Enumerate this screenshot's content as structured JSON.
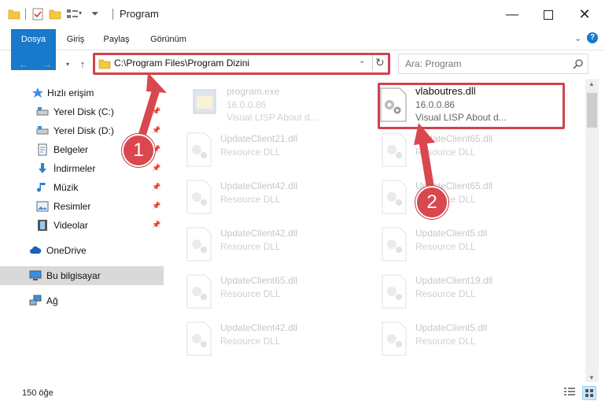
{
  "window": {
    "title": "Program"
  },
  "ribbon": {
    "tabs": [
      "Dosya",
      "Giriş",
      "Paylaş",
      "Görünüm"
    ]
  },
  "address": {
    "path": "C:\\Program Files\\Program Dizini"
  },
  "search": {
    "placeholder": "Ara: Program"
  },
  "sidebar": {
    "items": [
      {
        "label": "Hızlı erişim",
        "icon": "star-icon"
      },
      {
        "label": "Yerel Disk (C:)",
        "icon": "drive-icon",
        "pinned": true
      },
      {
        "label": "Yerel Disk (D:)",
        "icon": "drive-icon",
        "pinned": true
      },
      {
        "label": "Belgeler",
        "icon": "documents-icon",
        "pinned": true
      },
      {
        "label": "İndirmeler",
        "icon": "download-icon",
        "pinned": true
      },
      {
        "label": "Müzik",
        "icon": "music-icon",
        "pinned": true
      },
      {
        "label": "Resimler",
        "icon": "pictures-icon",
        "pinned": true
      },
      {
        "label": "Videolar",
        "icon": "video-icon",
        "pinned": true
      },
      {
        "label": "OneDrive",
        "icon": "cloud-icon"
      },
      {
        "label": "Bu bilgisayar",
        "icon": "computer-icon"
      },
      {
        "label": "Ağ",
        "icon": "network-icon"
      }
    ]
  },
  "files": {
    "highlighted": {
      "name": "vlaboutres.dll",
      "version": "16.0.0.86",
      "description": "Visual LISP About d..."
    },
    "program": {
      "name": "program.exe",
      "version": "16.0.0.86",
      "description": "Visual LISP About d..."
    },
    "left_column": [
      {
        "name": "UpdateClient21.dll",
        "description": "Resource DLL"
      },
      {
        "name": "UpdateClient42.dll",
        "description": "Resource DLL"
      },
      {
        "name": "UpdateClient42.dll",
        "description": "Resource DLL"
      },
      {
        "name": "UpdateClient65.dll",
        "description": "Resource DLL"
      },
      {
        "name": "UpdateClient42.dll",
        "description": "Resource DLL"
      }
    ],
    "right_column": [
      {
        "name": "UpdateClient65.dll",
        "description": "Resource DLL"
      },
      {
        "name": "UpdateClient65.dll",
        "description": "Resource DLL"
      },
      {
        "name": "UpdateClient5.dll",
        "description": "Resource DLL"
      },
      {
        "name": "UpdateClient19.dll",
        "description": "Resource DLL"
      },
      {
        "name": "UpdateClient5.dll",
        "description": "Resource DLL"
      }
    ]
  },
  "status": {
    "count": "150 öğe"
  },
  "annotations": {
    "step1": "1",
    "step2": "2",
    "color": "#d9474f"
  }
}
